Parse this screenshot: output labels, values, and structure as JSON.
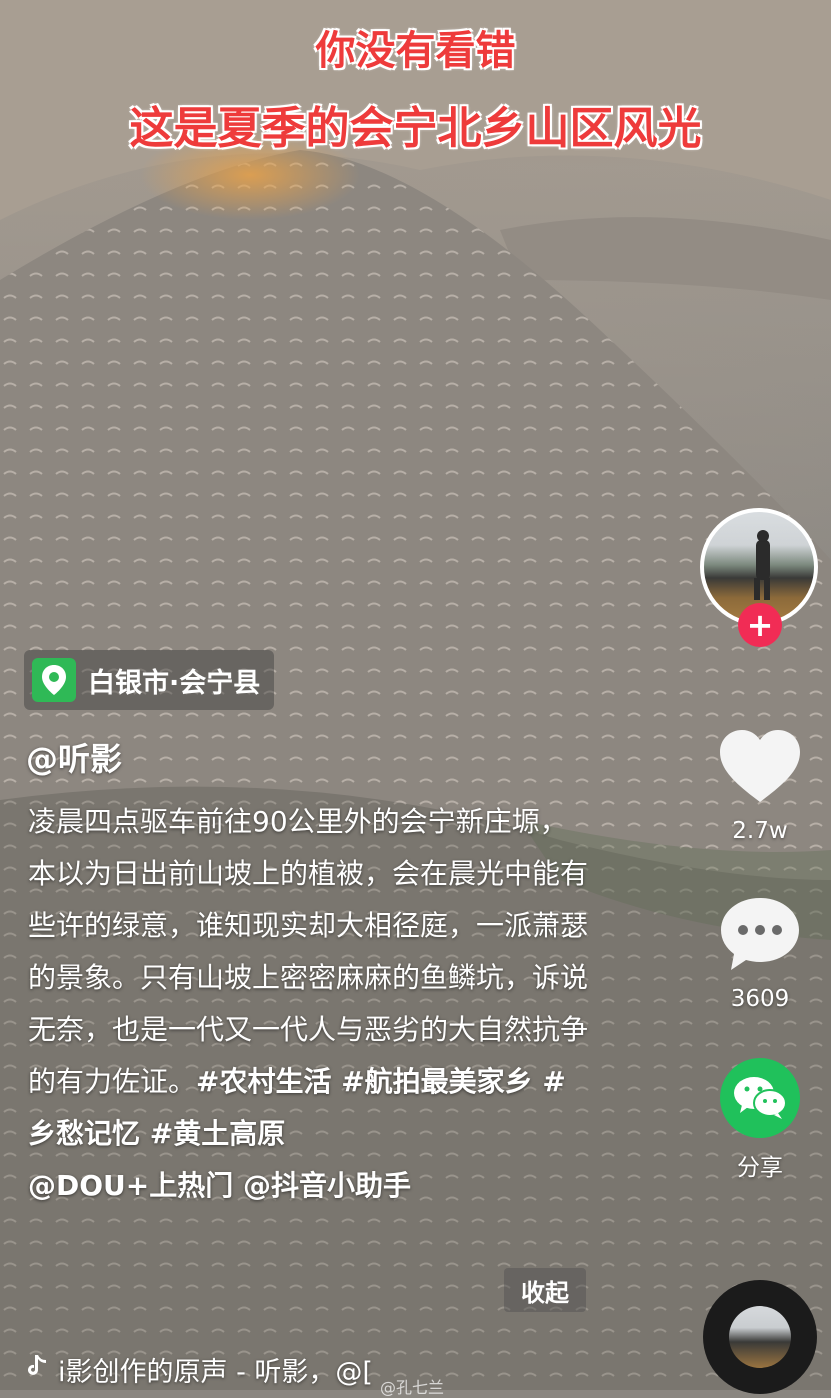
{
  "caption": {
    "line1": "你没有看错",
    "line2": "这是夏季的会宁北乡山区风光"
  },
  "location": {
    "icon": "location-pin-icon",
    "text": "白银市·会宁县"
  },
  "author": "@听影",
  "description": {
    "text": "凌晨四点驱车前往90公里外的会宁新庄塬，本以为日出前山坡上的植被，会在晨光中能有些许的绿意，谁知现实却大相径庭，一派萧瑟的景象。只有山坡上密密麻麻的鱼鳞坑，诉说无奈，也是一代又一代人与恶劣的大自然抗争的有力佐证。",
    "tags": "#农村生活 #航拍最美家乡 #乡愁记忆 #黄土高原",
    "mentions": "@DOU+上热门 @抖音小助手"
  },
  "collapse_label": "收起",
  "music": {
    "icon": "tiktok-note-icon",
    "text": "i影创作的原声 - 听影，@["
  },
  "watermark": "@孔七兰",
  "rail": {
    "follow_symbol": "+",
    "like_count": "2.7w",
    "comment_count": "3609",
    "share_label": "分享"
  },
  "colors": {
    "caption_red": "#ee3b3b",
    "follow_pink": "#f12c55",
    "wechat_green": "#20c15b",
    "location_green": "#2fb956"
  }
}
